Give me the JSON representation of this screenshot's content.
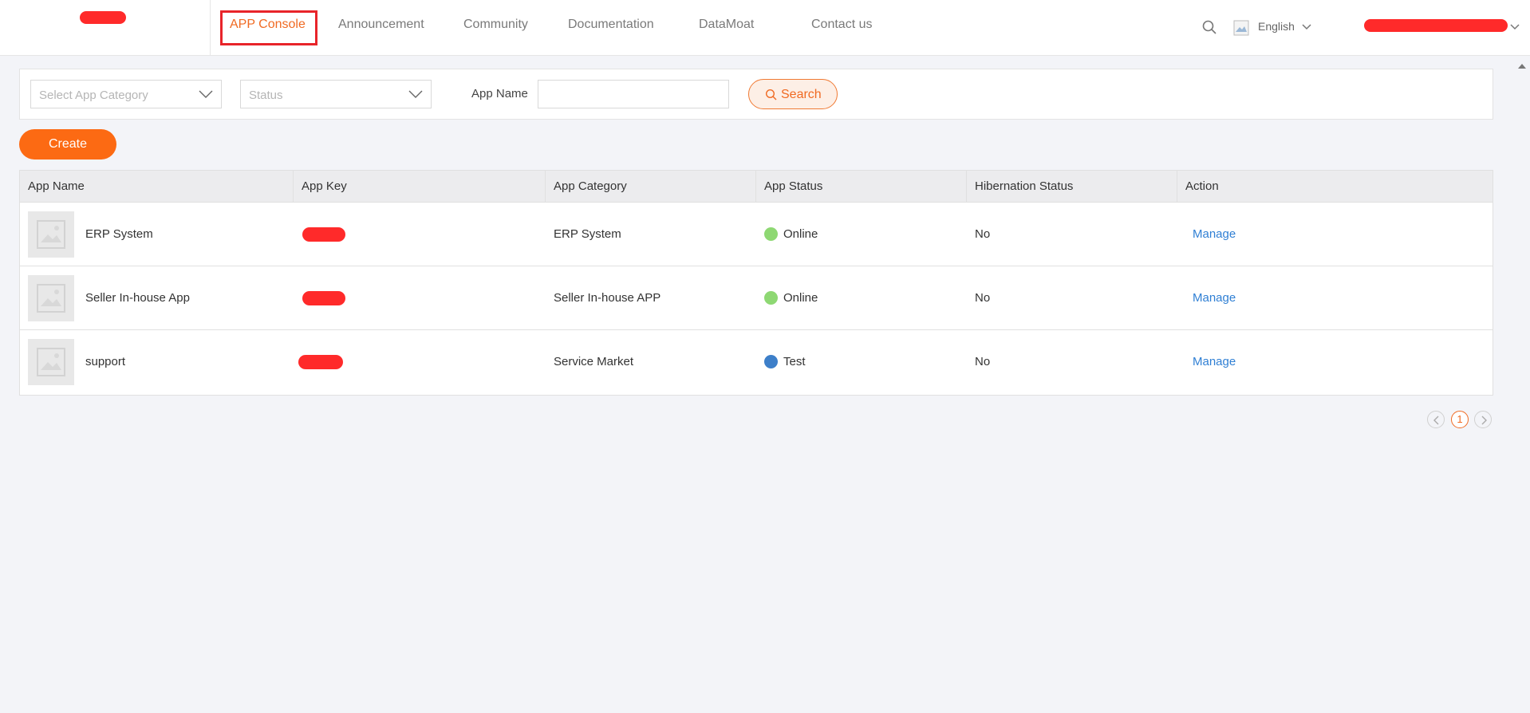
{
  "header": {
    "nav": [
      {
        "label": "APP Console",
        "active": true
      },
      {
        "label": "Announcement"
      },
      {
        "label": "Community"
      },
      {
        "label": "Documentation"
      },
      {
        "label": "DataMoat"
      },
      {
        "label": "Contact us"
      }
    ],
    "language": "English",
    "icons": [
      "search-icon",
      "globe-icon",
      "chevron-down-icon"
    ]
  },
  "filters": {
    "category_placeholder": "Select App Category",
    "status_placeholder": "Status",
    "app_name_label": "App Name",
    "app_name_value": "",
    "search_label": "Search"
  },
  "create_label": "Create",
  "table": {
    "columns": [
      "App Name",
      "App Key",
      "App Category",
      "App Status",
      "Hibernation Status",
      "Action"
    ],
    "rows": [
      {
        "name": "ERP System",
        "category": "ERP System",
        "status": "Online",
        "status_color": "#8ed873",
        "hibernation": "No",
        "action": "Manage"
      },
      {
        "name": "Seller In-house App",
        "category": "Seller In-house APP",
        "status": "Online",
        "status_color": "#8ed873",
        "hibernation": "No",
        "action": "Manage"
      },
      {
        "name": "support",
        "category": "Service Market",
        "status": "Test",
        "status_color": "#3d7fc9",
        "hibernation": "No",
        "action": "Manage"
      }
    ]
  },
  "pagination": {
    "current": "1"
  },
  "colors": {
    "accent": "#f06a22",
    "link": "#2f7fd4",
    "redaction": "#ff2a2a"
  }
}
